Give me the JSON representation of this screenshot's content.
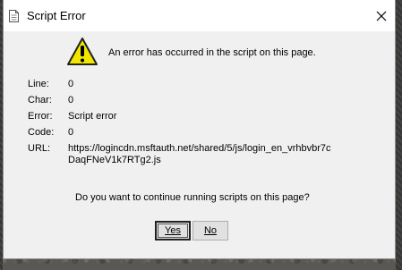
{
  "window": {
    "title": "Script Error",
    "message": "An error has occurred in the script on this page."
  },
  "details": [
    {
      "label": "Line:",
      "value": "0"
    },
    {
      "label": "Char:",
      "value": "0"
    },
    {
      "label": "Error:",
      "value": "Script error"
    },
    {
      "label": "Code:",
      "value": "0"
    },
    {
      "label": "URL:",
      "value": "https://logincdn.msftauth.net/shared/5/js/login_en_vrhbvbr7c DaqFNeV1k7RTg2.js"
    }
  ],
  "question": "Do you want to continue running scripts on this page?",
  "buttons": {
    "yes_label": "Yes",
    "no_label": "No"
  },
  "icons": {
    "app": "document-icon",
    "warning": "warning-icon",
    "close": "close-icon"
  },
  "colors": {
    "warning_fill": "#f2e600",
    "dialog_bg": "#f0f0f0",
    "titlebar_bg": "#ffffff"
  }
}
